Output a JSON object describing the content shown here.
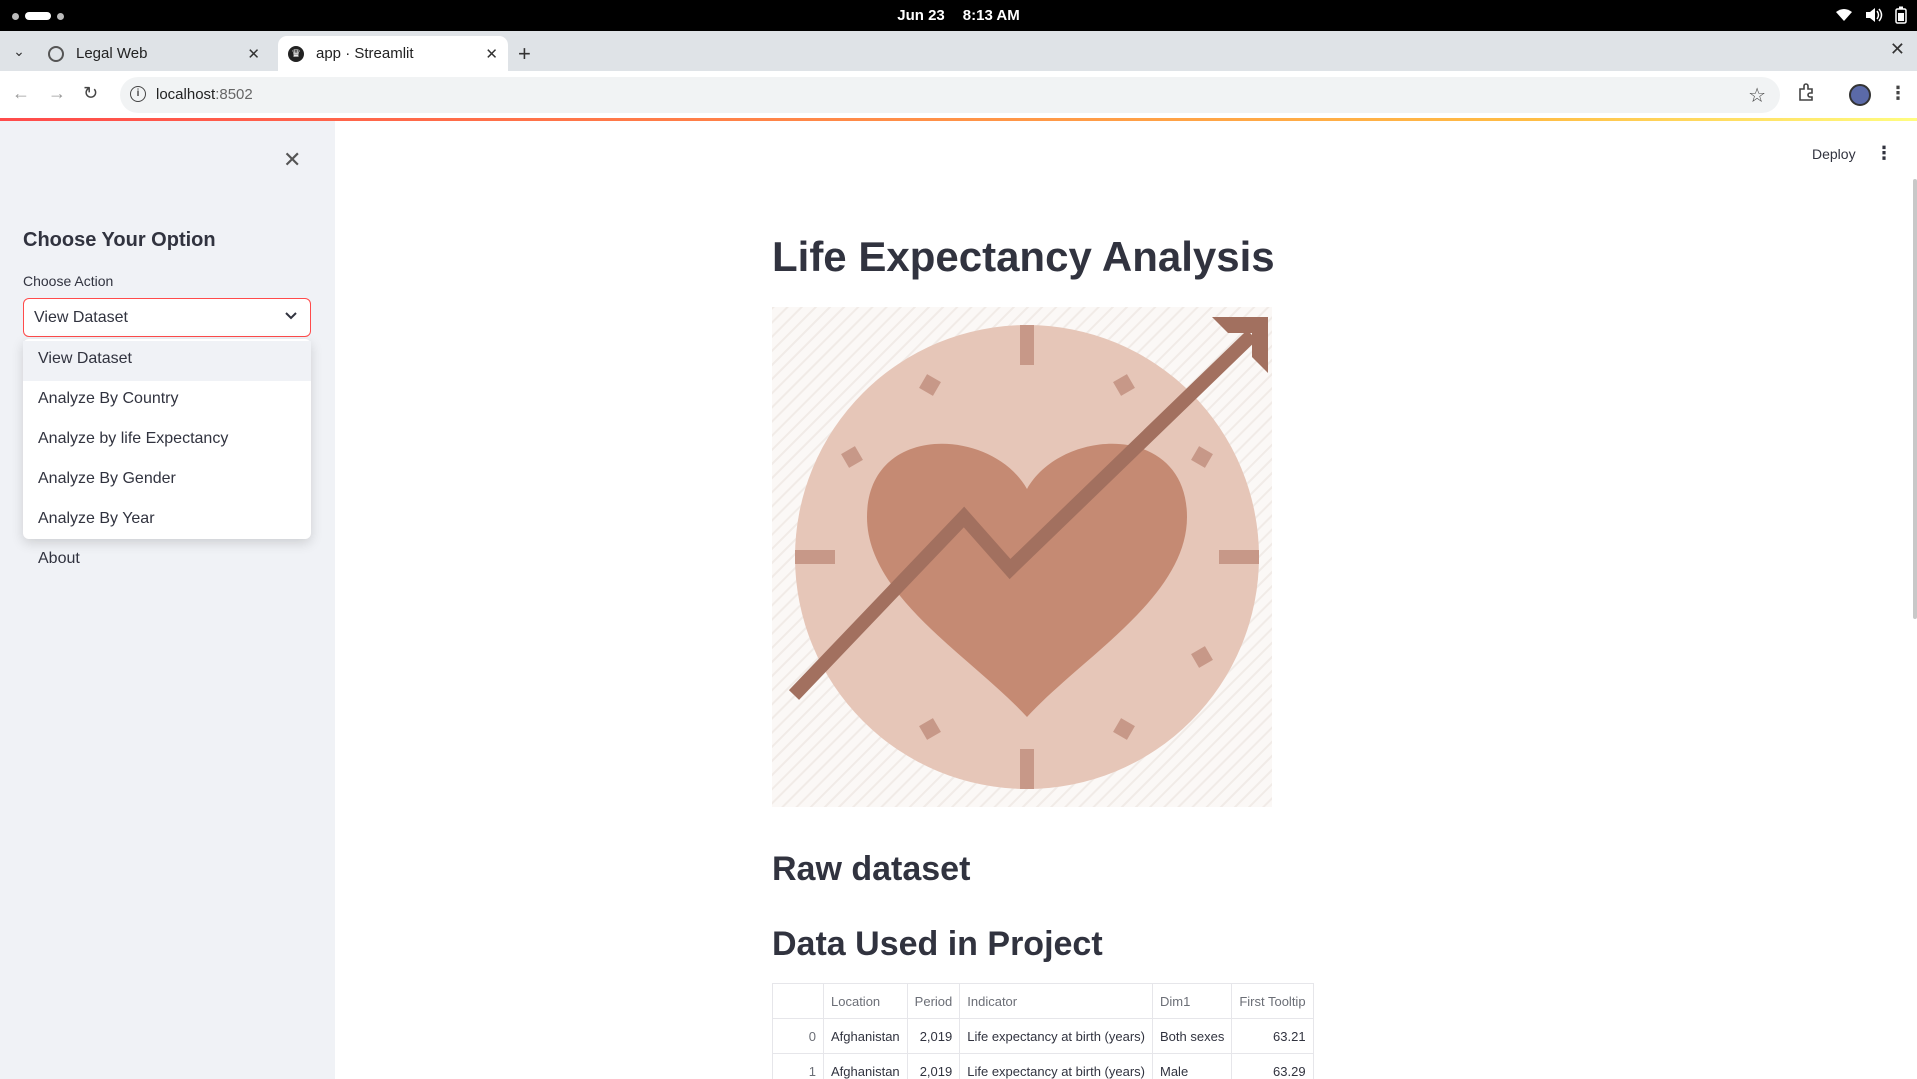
{
  "os": {
    "date": "Jun 23",
    "time": "8:13 AM"
  },
  "browser": {
    "tabs": [
      {
        "label": "Legal Web"
      },
      {
        "label": "app · Streamlit"
      }
    ],
    "url_host": "localhost",
    "url_port": ":8502"
  },
  "sidebar": {
    "title": "Choose Your Option",
    "select_label": "Choose Action",
    "select_value": "View Dataset",
    "options": [
      "View Dataset",
      "Analyze By Country",
      "Analyze by life Expectancy",
      "Analyze By Gender",
      "Analyze By Year",
      "About"
    ]
  },
  "header": {
    "deploy_label": "Deploy"
  },
  "main": {
    "title": "Life Expectancy Analysis",
    "section_raw": "Raw dataset",
    "section_used": "Data Used in Project",
    "table": {
      "columns": [
        "",
        "Location",
        "Period",
        "Indicator",
        "Dim1",
        "First Tooltip"
      ],
      "rows": [
        [
          "0",
          "Afghanistan",
          "2,019",
          "Life expectancy at birth (years)",
          "Both sexes",
          "63.21"
        ],
        [
          "1",
          "Afghanistan",
          "2,019",
          "Life expectancy at birth (years)",
          "Male",
          "63.29"
        ]
      ]
    }
  },
  "colors": {
    "accent": "#ff4b4b",
    "sidebar_bg": "#f0f2f6",
    "hero_circle": "#e6c6b8",
    "hero_heart": "#c58a73",
    "hero_arrow": "#a2705f"
  }
}
